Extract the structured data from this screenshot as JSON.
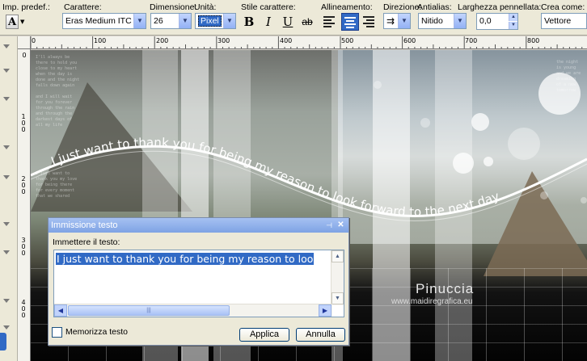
{
  "toolbar": {
    "preset_label": "Imp. predef.:",
    "preset_glyph": "A",
    "font_label": "Carattere:",
    "font_value": "Eras Medium ITC",
    "size_label": "Dimensione:",
    "size_value": "26",
    "unit_label": "Unità:",
    "unit_value": "Pixel",
    "style_label": "Stile carattere:",
    "bold": "B",
    "italic": "I",
    "underline": "U",
    "strike": "ab",
    "align_label": "Allineamento:",
    "direction_label": "Direzione:",
    "antialias_label": "Antialias:",
    "antialias_value": "Nitido",
    "stroke_label": "Larghezza pennellata:",
    "stroke_value": "0,0",
    "create_label": "Crea come:",
    "create_value": "Vettore"
  },
  "rulers": {
    "horizontal": [
      "0",
      "100",
      "200",
      "300",
      "400",
      "500",
      "600",
      "700",
      "800"
    ],
    "vertical": [
      "0",
      "100",
      "200",
      "300",
      "400"
    ]
  },
  "canvas": {
    "curve_text": "I just want to thank you for being my reason to look forward to the next day",
    "watermark_name": "Pinuccia",
    "watermark_url": "www.maidiregrafica.eu"
  },
  "dialog": {
    "title": "Immissione testo",
    "prompt": "Immettere il testo:",
    "text_value": "I just want to thank you for being my reason to loo",
    "remember_label": "Memorizza testo",
    "apply_label": "Applica",
    "cancel_label": "Annulla"
  },
  "colors": {
    "selection": "#316ac5",
    "titlebar": "#7ea3e4",
    "toolbar_bg": "#ece9d8"
  }
}
